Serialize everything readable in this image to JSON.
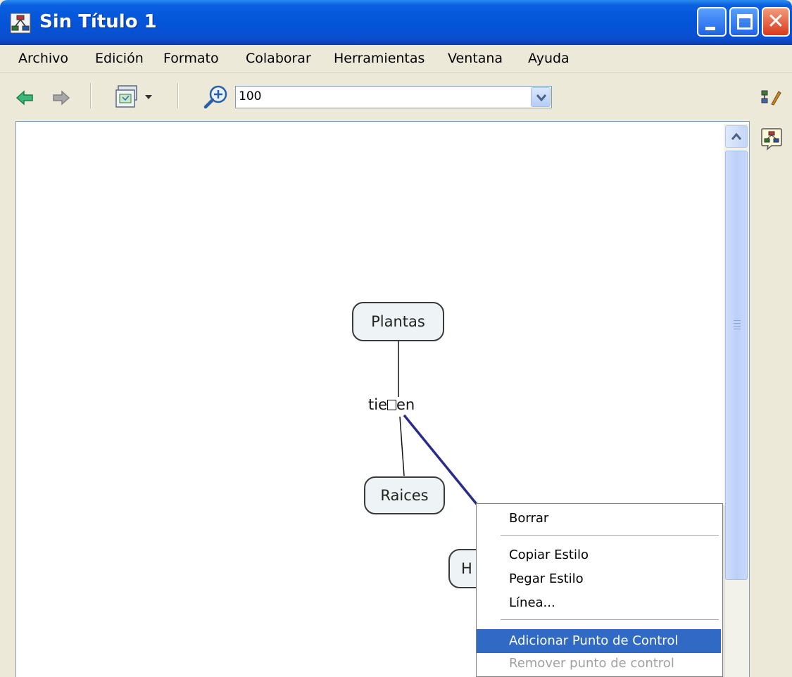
{
  "window": {
    "title": "Sin Título 1",
    "accent": "#0454d8"
  },
  "menubar": {
    "items": [
      "Archivo",
      "Edición",
      "Formato",
      "Colaborar",
      "Herramientas",
      "Ventana",
      "Ayuda"
    ]
  },
  "toolbar": {
    "back_icon": "back-arrow-icon",
    "forward_icon": "forward-arrow-icon",
    "view_icon": "view-menu-icon",
    "zoom_icon": "zoom-in-icon",
    "zoom_value": "100"
  },
  "side_panel": {
    "styles_icon": "styles-palette-icon",
    "cmap_icon": "concept-map-icon"
  },
  "concept_map": {
    "nodes": [
      "Plantas",
      "Raices",
      "H"
    ],
    "link_label": "tie",
    "link_label_tail": "en",
    "selected_link_color": "#2b2b8a"
  },
  "context_menu": {
    "items": {
      "borrar": "Borrar",
      "copiar_estilo": "Copiar Estilo",
      "pegar_estilo": "Pegar Estilo",
      "linea": "Línea...",
      "adicionar_punto": "Adicionar Punto de Control",
      "remover_punto": "Remover punto de control"
    },
    "highlight_color": "#316ac5"
  }
}
